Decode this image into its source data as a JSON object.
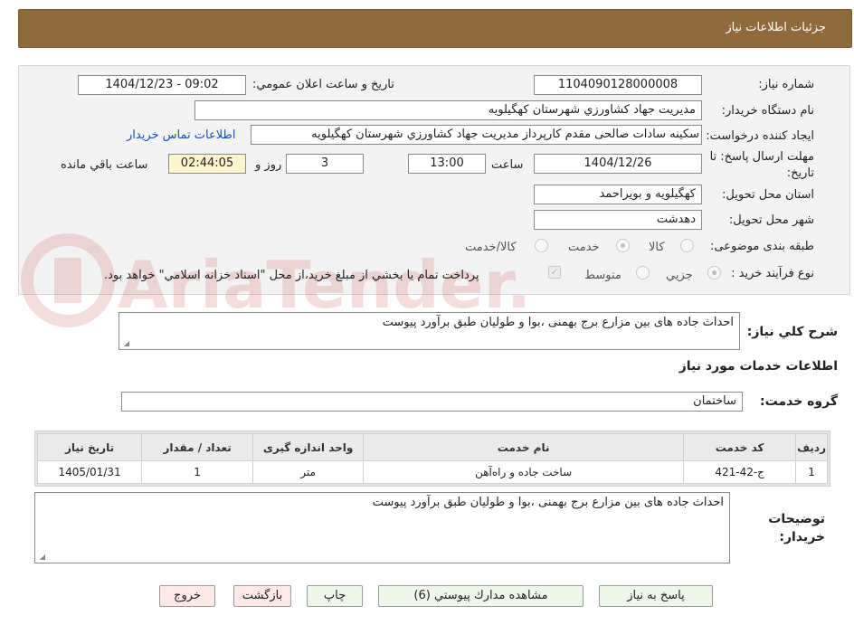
{
  "header": {
    "title": "جزئیات اطلاعات نیاز"
  },
  "form": {
    "need_number_label": "شماره نیاز:",
    "need_number": "1104090128000008",
    "announce_label": "تاریخ و ساعت اعلان عمومي:",
    "announce_value": "1404/12/23 - 09:02",
    "buyer_org_label": "نام دستگاه خريدار:",
    "buyer_org": "مديريت جهاد كشاورزي شهرستان كهگيلويه",
    "requester_label": "ايجاد كننده درخواست:",
    "requester": "سكينه سادات صالحی مقدم كارپرداز مديريت جهاد كشاورزي شهرستان كهگيلويه",
    "contact_link": "اطلاعات تماس خريدار",
    "deadline_label_1": "مهلت ارسال پاسخ: تا",
    "deadline_label_2": "تاريخ:",
    "deadline_date": "1404/12/26",
    "hour_label": "ساعت",
    "deadline_time": "13:00",
    "days_value": "3",
    "days_label": "روز و",
    "remaining_time": "02:44:05",
    "remaining_label": "ساعت باقي مانده",
    "province_label": "استان محل تحويل:",
    "province": "كهگيلويه و بويراحمد",
    "city_label": "شهر محل تحويل:",
    "city": "دهدشت",
    "category_label": "طبقه بندی موضوعی:",
    "category_options": [
      "كالا",
      "خدمت",
      "كالا/خدمت"
    ],
    "category_selected": "خدمت",
    "process_label": "نوع فرآيند خريد :",
    "process_options": [
      "جزيي",
      "متوسط"
    ],
    "process_selected": "جزيي",
    "payment_note": "پرداخت تمام يا بخشي از مبلغ خريد،از محل \"اسناد خزانه اسلامي\" خواهد بود."
  },
  "description": {
    "label": "شرح كلي نياز:",
    "text": "احداث جاده های بین مزارع برج بهمنی ،بوا و طولیان طبق برآورد پیوست"
  },
  "services": {
    "section_title": "اطلاعات خدمات مورد نياز",
    "group_label": "گروه خدمت:",
    "group_value": "ساختمان",
    "table_headers": [
      "رديف",
      "كد خدمت",
      "نام خدمت",
      "واحد اندازه گيری",
      "تعداد / مقدار",
      "تاريخ نياز"
    ],
    "rows": [
      {
        "index": "1",
        "code": "ج-42-421",
        "name": "ساخت جاده و راه‌آهن",
        "unit": "متر",
        "qty": "1",
        "date": "1405/01/31"
      }
    ]
  },
  "buyer_notes": {
    "label_1": "توضيحات",
    "label_2": "خريدار:",
    "text": "احداث جاده های بین مزارع برج بهمنی ،بوا و طولیان طبق برآورد پیوست"
  },
  "buttons": {
    "reply": "پاسخ به نياز",
    "attachments": "مشاهده مدارك پيوستي (6)",
    "print": "چاپ",
    "back": "بازگشت",
    "exit": "خروج"
  },
  "watermark": {
    "brand": "AriaTender.neT"
  },
  "colors": {
    "header_bg": "#8f6a3c",
    "panel_bg": "#f3f3f3",
    "link": "#1a4fb8",
    "timer_bg": "#fbf4cc",
    "button_green": "#eef7ea",
    "button_pink": "#fde7e7"
  }
}
